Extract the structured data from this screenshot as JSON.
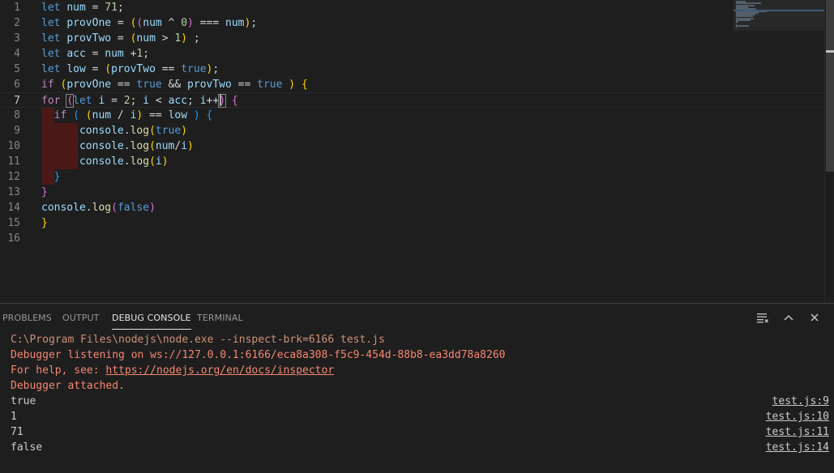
{
  "editor": {
    "line_numbers": [
      "1",
      "2",
      "3",
      "4",
      "5",
      "6",
      "7",
      "8",
      "9",
      "10",
      "11",
      "12",
      "13",
      "14",
      "15",
      "16"
    ],
    "lines": [
      [
        [
          "kw",
          "let"
        ],
        [
          "op",
          " "
        ],
        [
          "id",
          "num"
        ],
        [
          "op",
          " = "
        ],
        [
          "num",
          "71"
        ],
        [
          "op",
          ";"
        ]
      ],
      [
        [
          "kw",
          "let"
        ],
        [
          "op",
          " "
        ],
        [
          "id",
          "provOne"
        ],
        [
          "op",
          " = "
        ],
        [
          "b1",
          "("
        ],
        [
          "b2",
          "("
        ],
        [
          "id",
          "num"
        ],
        [
          "op",
          " ^ "
        ],
        [
          "num",
          "0"
        ],
        [
          "b2",
          ")"
        ],
        [
          "op",
          " === "
        ],
        [
          "id",
          "num"
        ],
        [
          "b1",
          ")"
        ],
        [
          "op",
          ";"
        ]
      ],
      [
        [
          "kw",
          "let"
        ],
        [
          "op",
          " "
        ],
        [
          "id",
          "provTwo"
        ],
        [
          "op",
          " = "
        ],
        [
          "b1",
          "("
        ],
        [
          "id",
          "num"
        ],
        [
          "op",
          " > "
        ],
        [
          "num",
          "1"
        ],
        [
          "b1",
          ")"
        ],
        [
          "op",
          " ;"
        ]
      ],
      [
        [
          "kw",
          "let"
        ],
        [
          "op",
          " "
        ],
        [
          "id",
          "acc"
        ],
        [
          "op",
          " = "
        ],
        [
          "id",
          "num"
        ],
        [
          "op",
          " +"
        ],
        [
          "num",
          "1"
        ],
        [
          "op",
          ";"
        ]
      ],
      [
        [
          "kw",
          "let"
        ],
        [
          "op",
          " "
        ],
        [
          "id",
          "low"
        ],
        [
          "op",
          " = "
        ],
        [
          "b1",
          "("
        ],
        [
          "id",
          "provTwo"
        ],
        [
          "op",
          " == "
        ],
        [
          "kw",
          "true"
        ],
        [
          "b1",
          ")"
        ],
        [
          "op",
          ";"
        ]
      ],
      [
        [
          "ctl",
          "if"
        ],
        [
          "op",
          " "
        ],
        [
          "b1",
          "("
        ],
        [
          "id",
          "provOne"
        ],
        [
          "op",
          " == "
        ],
        [
          "kw",
          "true"
        ],
        [
          "op",
          " && "
        ],
        [
          "id",
          "provTwo"
        ],
        [
          "op",
          " == "
        ],
        [
          "kw",
          "true"
        ],
        [
          "op",
          " "
        ],
        [
          "b1",
          ")"
        ],
        [
          "op",
          " "
        ],
        [
          "b1",
          "{"
        ]
      ],
      [
        [
          "ctl",
          "for"
        ],
        [
          "op",
          " "
        ],
        [
          "b2m",
          "("
        ],
        [
          "kw",
          "let"
        ],
        [
          "op",
          " "
        ],
        [
          "id",
          "i"
        ],
        [
          "op",
          " = "
        ],
        [
          "num",
          "2"
        ],
        [
          "op",
          "; "
        ],
        [
          "id",
          "i"
        ],
        [
          "op",
          " < "
        ],
        [
          "id",
          "acc"
        ],
        [
          "op",
          "; "
        ],
        [
          "id",
          "i"
        ],
        [
          "op",
          "++"
        ],
        [
          "b2m",
          ")"
        ],
        [
          "op",
          " "
        ],
        [
          "b2",
          "{"
        ]
      ],
      [
        [
          "ind1",
          ""
        ],
        [
          "op",
          "  "
        ],
        [
          "ctl",
          "if"
        ],
        [
          "op",
          " "
        ],
        [
          "b3",
          "("
        ],
        [
          "op",
          " "
        ],
        [
          "b1",
          "("
        ],
        [
          "id",
          "num"
        ],
        [
          "op",
          " / "
        ],
        [
          "id",
          "i"
        ],
        [
          "b1",
          ")"
        ],
        [
          "op",
          " == "
        ],
        [
          "id",
          "low"
        ],
        [
          "op",
          " "
        ],
        [
          "b3",
          ")"
        ],
        [
          "op",
          " "
        ],
        [
          "b3",
          "{"
        ]
      ],
      [
        [
          "ind2",
          ""
        ],
        [
          "op",
          "      "
        ],
        [
          "id",
          "console"
        ],
        [
          "op",
          "."
        ],
        [
          "fn",
          "log"
        ],
        [
          "b1",
          "("
        ],
        [
          "kw",
          "true"
        ],
        [
          "b1",
          ")"
        ]
      ],
      [
        [
          "ind2",
          ""
        ],
        [
          "op",
          "      "
        ],
        [
          "id",
          "console"
        ],
        [
          "op",
          "."
        ],
        [
          "fn",
          "log"
        ],
        [
          "b1",
          "("
        ],
        [
          "id",
          "num"
        ],
        [
          "op",
          "/"
        ],
        [
          "id",
          "i"
        ],
        [
          "b1",
          ")"
        ]
      ],
      [
        [
          "ind2",
          ""
        ],
        [
          "op",
          "      "
        ],
        [
          "id",
          "console"
        ],
        [
          "op",
          "."
        ],
        [
          "fn",
          "log"
        ],
        [
          "b1",
          "("
        ],
        [
          "id",
          "i"
        ],
        [
          "b1",
          ")"
        ]
      ],
      [
        [
          "ind1",
          ""
        ],
        [
          "op",
          "  "
        ],
        [
          "b3",
          "}"
        ]
      ],
      [
        [
          "b2",
          "}"
        ]
      ],
      [
        [
          "id",
          "console"
        ],
        [
          "op",
          "."
        ],
        [
          "fn",
          "log"
        ],
        [
          "b2",
          "("
        ],
        [
          "kw",
          "false"
        ],
        [
          "b2",
          ")"
        ]
      ],
      [
        [
          "b1",
          "}"
        ]
      ],
      []
    ],
    "current_line": 7
  },
  "panel": {
    "tabs": [
      {
        "label": "PROBLEMS",
        "active": false
      },
      {
        "label": "OUTPUT",
        "active": false
      },
      {
        "label": "DEBUG CONSOLE",
        "active": true
      },
      {
        "label": "TERMINAL",
        "active": false
      }
    ],
    "console": [
      {
        "text": "C:\\Program Files\\nodejs\\node.exe --inspect-brk=6166 test.js",
        "kind": "orange",
        "source": ""
      },
      {
        "text": "Debugger listening on ws://127.0.0.1:6166/eca8a308-f5c9-454d-88b8-ea3dd78a8260",
        "kind": "red",
        "source": ""
      },
      {
        "text_prefix": "For help, see: ",
        "link": "https://nodejs.org/en/docs/inspector",
        "kind": "red",
        "source": ""
      },
      {
        "text": "Debugger attached.",
        "kind": "red",
        "source": ""
      },
      {
        "text": "true",
        "kind": "plain",
        "source": "test.js:9"
      },
      {
        "text": "1",
        "kind": "plain",
        "source": "test.js:10"
      },
      {
        "text": "71",
        "kind": "plain",
        "source": "test.js:11"
      },
      {
        "text": "false",
        "kind": "plain",
        "source": "test.js:14"
      }
    ]
  },
  "icons": {
    "clear": "clear-console-icon",
    "maximize": "chevron-up-icon",
    "close": "close-icon"
  }
}
